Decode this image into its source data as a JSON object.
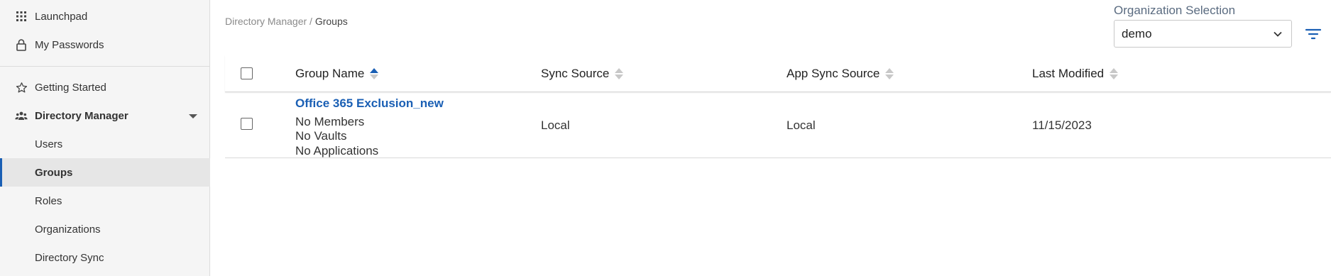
{
  "sidebar": {
    "items": [
      {
        "label": "Launchpad",
        "icon": "grid-icon"
      },
      {
        "label": "My Passwords",
        "icon": "lock-icon"
      },
      {
        "label": "Getting Started",
        "icon": "star-icon"
      },
      {
        "label": "Directory Manager",
        "icon": "users-icon"
      },
      {
        "label": "Users"
      },
      {
        "label": "Groups"
      },
      {
        "label": "Roles"
      },
      {
        "label": "Organizations"
      },
      {
        "label": "Directory Sync"
      }
    ]
  },
  "breadcrumb": {
    "parent": "Directory Manager",
    "separator": " / ",
    "current": "Groups"
  },
  "org_selection": {
    "label": "Organization Selection",
    "value": "demo"
  },
  "table": {
    "columns": [
      "Group Name",
      "Sync Source",
      "App Sync Source",
      "Last Modified"
    ],
    "sort": {
      "column": "Group Name",
      "direction": "ascending"
    },
    "rows": [
      {
        "group_name": "Office 365 Exclusion_new",
        "members": "No Members",
        "vaults": "No Vaults",
        "applications": "No Applications",
        "sync_source": "Local",
        "app_sync_source": "Local",
        "last_modified": "11/15/2023"
      }
    ]
  },
  "colors": {
    "accent": "#1a5fb4",
    "sidebar_bg": "#f5f5f5",
    "active_bg": "#e6e6e6"
  }
}
